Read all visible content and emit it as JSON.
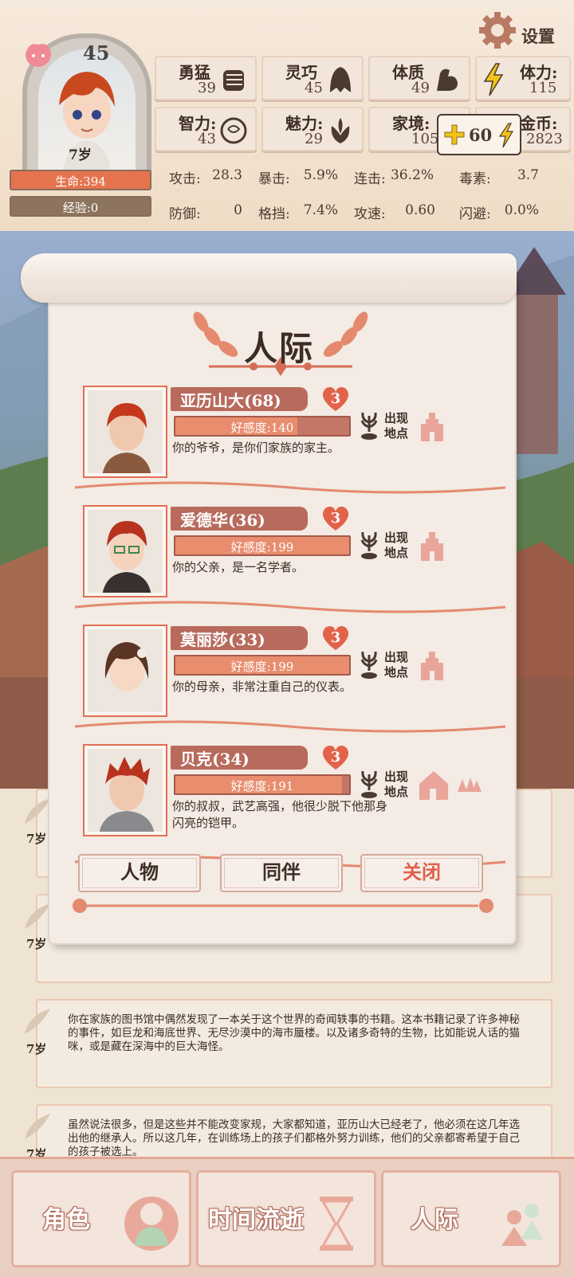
{
  "header": {
    "settings_label": "设置",
    "level": "45",
    "age": "7岁",
    "hp_label": "生命:394",
    "xp_label": "经验:0",
    "attributes": [
      {
        "name": "勇猛",
        "value": "39",
        "icon": "fist-icon"
      },
      {
        "name": "灵巧",
        "value": "45",
        "icon": "cloak-icon"
      },
      {
        "name": "体质",
        "value": "49",
        "icon": "muscle-arm-icon"
      },
      {
        "name": "智力:",
        "value": "43",
        "icon": "brain-icon"
      },
      {
        "name": "魅力:",
        "value": "29",
        "icon": "flower-icon"
      },
      {
        "name": "家境:",
        "value": "105",
        "icon": "house-icon"
      }
    ],
    "stamina": {
      "name": "体力:",
      "value": "115"
    },
    "gold": {
      "name": "金币:",
      "value": "2823"
    },
    "bonus_value": "60",
    "combat_stats": [
      {
        "label": "攻击:",
        "value": "28.3"
      },
      {
        "label": "暴击:",
        "value": "5.9%"
      },
      {
        "label": "连击:",
        "value": "36.2%"
      },
      {
        "label": "毒素:",
        "value": "3.7"
      },
      {
        "label": "防御:",
        "value": "0"
      },
      {
        "label": "格挡:",
        "value": "7.4%"
      },
      {
        "label": "攻速:",
        "value": "0.60"
      },
      {
        "label": "闪避:",
        "value": "0.0%"
      }
    ]
  },
  "dialog": {
    "title": "人际",
    "location_label": "出现\n地点",
    "characters": [
      {
        "name": "亚历山大(68)",
        "hearts": "3",
        "favor": "好感度:140",
        "favor_fraction": 0.7,
        "desc": "你的爷爷，是你们家族的家主。",
        "place": "castle"
      },
      {
        "name": "爱德华(36)",
        "hearts": "3",
        "favor": "好感度:199",
        "favor_fraction": 1.0,
        "desc": "你的父亲，是一名学者。",
        "place": "castle"
      },
      {
        "name": "莫丽莎(33)",
        "hearts": "3",
        "favor": "好感度:199",
        "favor_fraction": 1.0,
        "desc": "你的母亲，非常注重自己的仪表。",
        "place": "castle"
      },
      {
        "name": "贝克(34)",
        "hearts": "3",
        "favor": "好感度:191",
        "favor_fraction": 0.96,
        "desc": "你的叔叔，武艺高强，他很少脱下他那身闪亮的铠甲。",
        "place": "forest-house"
      }
    ],
    "buttons": {
      "people": "人物",
      "companions": "同伴",
      "close": "关闭"
    }
  },
  "log": [
    {
      "age": "7岁",
      "text": ""
    },
    {
      "age": "7岁",
      "text": ""
    },
    {
      "age": "7岁",
      "text": "你在家族的图书馆中偶然发现了一本关于这个世界的奇闻轶事的书籍。这本书籍记录了许多神秘的事件，如巨龙和海底世界、无尽沙漠中的海市蜃楼。以及诸多奇特的生物，比如能说人话的猫咪，或是藏在深海中的巨大海怪。"
    },
    {
      "age": "7岁",
      "text": "虽然说法很多，但是这些并不能改变家规，大家都知道，亚历山大已经老了，他必须在这几年选出他的继承人。所以这几年，在训练场上的孩子们都格外努力训练，他们的父亲都寄希望于自己的孩子被选上。"
    }
  ],
  "nav": {
    "character": "角色",
    "time": "时间流逝",
    "social": "人际"
  },
  "colors": {
    "accent": "#e5734e",
    "paper": "#f3ebe4",
    "favor": "#e88e6e",
    "heart": "#e2624a"
  }
}
